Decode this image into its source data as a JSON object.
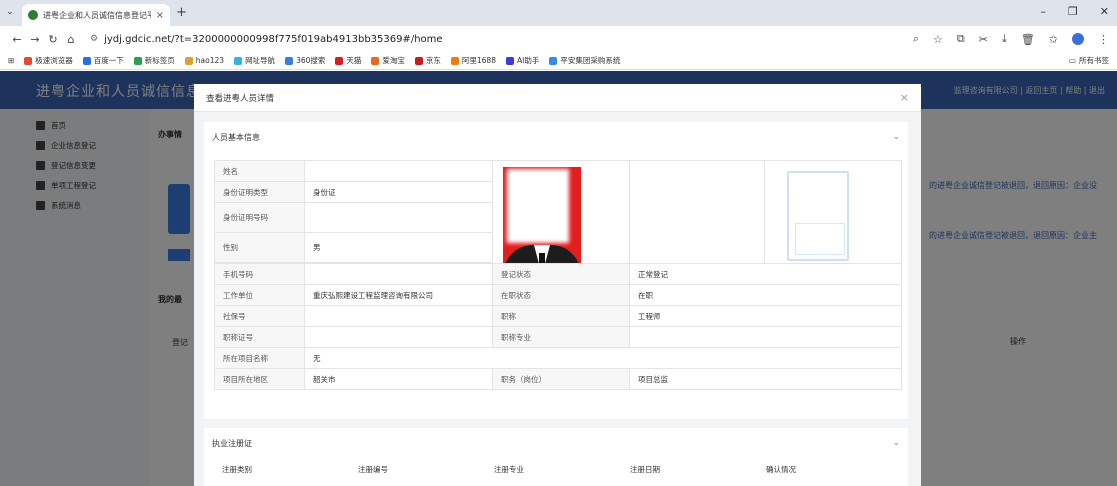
{
  "browser": {
    "tab_title": "进粤企业和人员诚信信息登记平",
    "url": "jydj.gdcic.net/?t=3200000000998f775f019ab4913bb35369#/home",
    "bookmarks": [
      "极速浏览器",
      "百度一下",
      "新标签页",
      "hao123",
      "网址导航",
      "360搜索",
      "天猫",
      "爱淘宝",
      "京东",
      "阿里1688",
      "AI助手",
      "平安集团采购系统"
    ],
    "bookmarks_right": "所有书签",
    "bookmark_colors": [
      "#e04a2f",
      "#2f6de0",
      "#2e9e4f",
      "#e0a02f",
      "#3bb0e0",
      "#3b7de0",
      "#d92020",
      "#e06a20",
      "#c41e1e",
      "#f07a10",
      "#3b3bd9",
      "#2f8fe0"
    ]
  },
  "app": {
    "title": "进粤企业和人员诚信信息登记平台",
    "header_right": "监理咨询有限公司 | 返回主页 | 帮助 | 退出",
    "sidebar": [
      "首页",
      "企业信息登记",
      "登记信息变更",
      "单项工程登记",
      "系统消息"
    ],
    "content_labels": {
      "tasks": "办事情",
      "mine": "我的最",
      "reg": "登记"
    },
    "notices": [
      "的进粤企业诚信登记被退回，退回原因：企业没",
      "的进粤企业诚信登记被退回，退回原因：企业主"
    ],
    "ops": "操作"
  },
  "modal": {
    "title": "查看进粤人员详情",
    "section1": "人员基本信息",
    "section2": "执业注册证",
    "fields": {
      "name_k": "姓名",
      "name_v": "",
      "idtype_k": "身份证明类型",
      "idtype_v": "身份证",
      "idno_k": "身份证明号码",
      "idno_v": "",
      "gender_k": "性别",
      "gender_v": "男",
      "phone_k": "手机号码",
      "phone_v": "",
      "status_k": "登记状态",
      "status_v": "正常登记",
      "unit_k": "工作单位",
      "unit_v": "重庆弘熙建设工程监理咨询有限公司",
      "job_k": "在职状态",
      "job_v": "在职",
      "ss_k": "社保号",
      "ss_v": "",
      "title_k": "职称",
      "title_v": "工程师",
      "titleno_k": "职称证号",
      "titleno_v": "",
      "major_k": "职称专业",
      "major_v": "",
      "proj_k": "所在项目名称",
      "proj_v": "无",
      "area_k": "项目所在地区",
      "area_v": "韶关市",
      "post_k": "职务（岗位）",
      "post_v": "项目总监"
    },
    "cert_headers": [
      "注册类别",
      "注册编号",
      "注册专业",
      "注册日期",
      "确认情况"
    ]
  }
}
